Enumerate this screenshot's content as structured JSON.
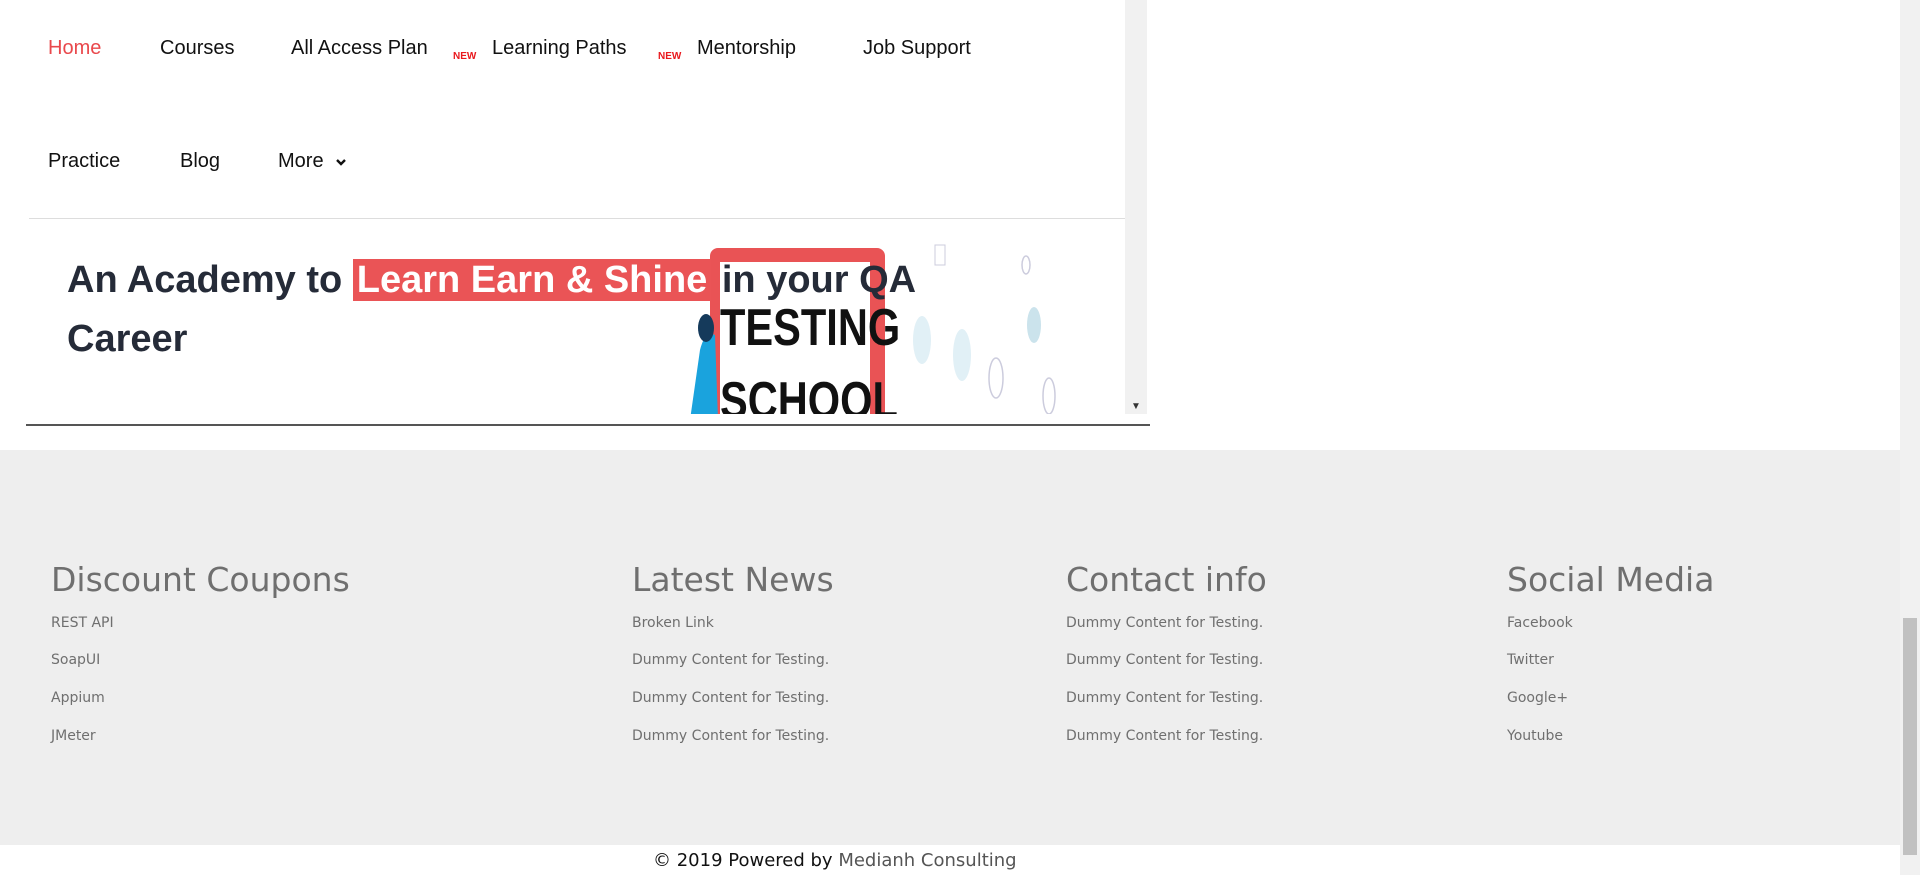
{
  "nav": {
    "row1": [
      {
        "label": "Home",
        "active": true
      },
      {
        "label": "Courses"
      },
      {
        "label": "All Access Plan",
        "badge": "NEW"
      },
      {
        "label": "Learning Paths",
        "badge": "NEW"
      },
      {
        "label": "Mentorship"
      },
      {
        "label": "Job Support"
      }
    ],
    "row2": [
      {
        "label": "Practice"
      },
      {
        "label": "Blog"
      },
      {
        "label": "More"
      }
    ]
  },
  "hero": {
    "before": "An Academy to",
    "highlight": "Learn Earn & Shine",
    "after": " in your QA",
    "line2": "Career",
    "image_text1": "TESTING",
    "image_text2": "SCHOOL"
  },
  "footer": {
    "columns": [
      {
        "title": "Discount Coupons",
        "links": [
          "REST API",
          "SoapUI",
          "Appium",
          "JMeter"
        ]
      },
      {
        "title": "Latest News",
        "links": [
          "Broken Link",
          "Dummy Content for Testing.",
          "Dummy Content for Testing.",
          "Dummy Content for Testing."
        ]
      },
      {
        "title": "Contact info",
        "links": [
          "Dummy Content for Testing.",
          "Dummy Content for Testing.",
          "Dummy Content for Testing.",
          "Dummy Content for Testing."
        ]
      },
      {
        "title": "Social Media",
        "links": [
          "Facebook",
          "Twitter",
          "Google+",
          "Youtube"
        ]
      }
    ],
    "copyright_prefix": "© 2019 Powered by ",
    "copyright_link": "Medianh Consulting"
  },
  "colors": {
    "accent": "#ea5456",
    "footer_bg": "#eeeeee"
  }
}
